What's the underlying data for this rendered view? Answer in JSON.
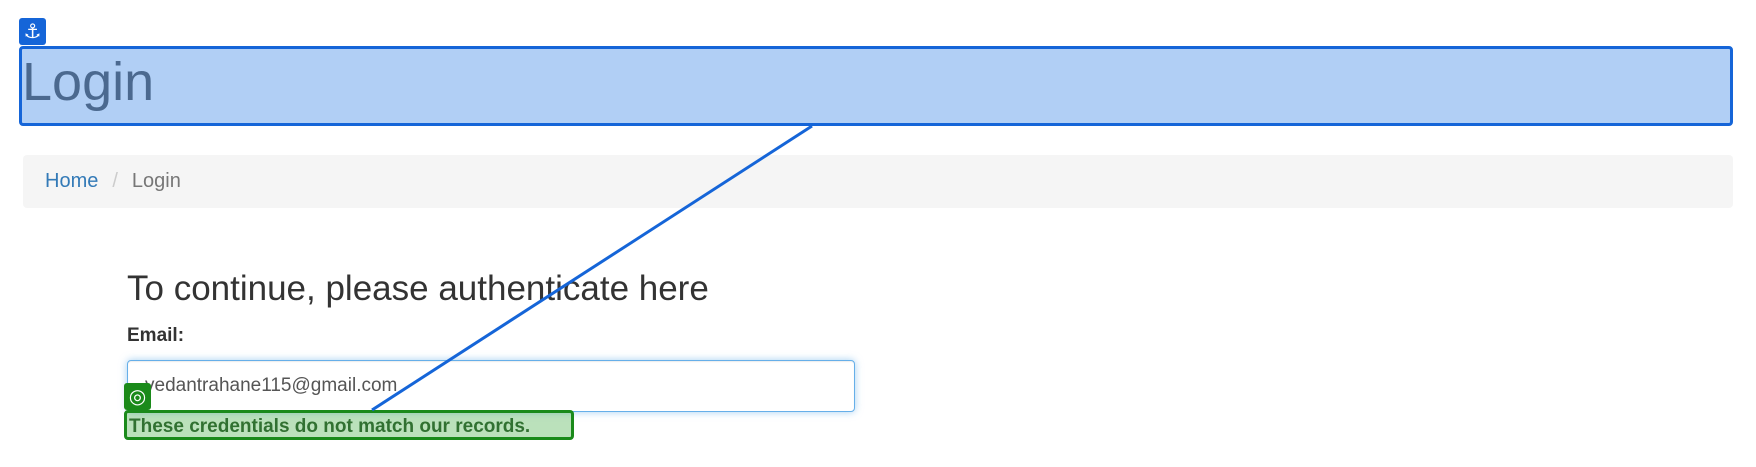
{
  "page": {
    "title": "Login"
  },
  "breadcrumb": {
    "home_label": "Home",
    "separator": "/",
    "current_label": "Login"
  },
  "form": {
    "heading": "To continue, please authenticate here",
    "email_label": "Email:",
    "email_value": "vedantrahane115@gmail.com",
    "error_message": "These credentials do not match our records."
  },
  "overlay": {
    "anchor_icon": "anchor-icon",
    "target_icon": "target-icon",
    "anchor_glyph": "⚓",
    "target_glyph": "◎",
    "colors": {
      "anchor": "#1565d8",
      "target": "#1a8a1a"
    }
  }
}
